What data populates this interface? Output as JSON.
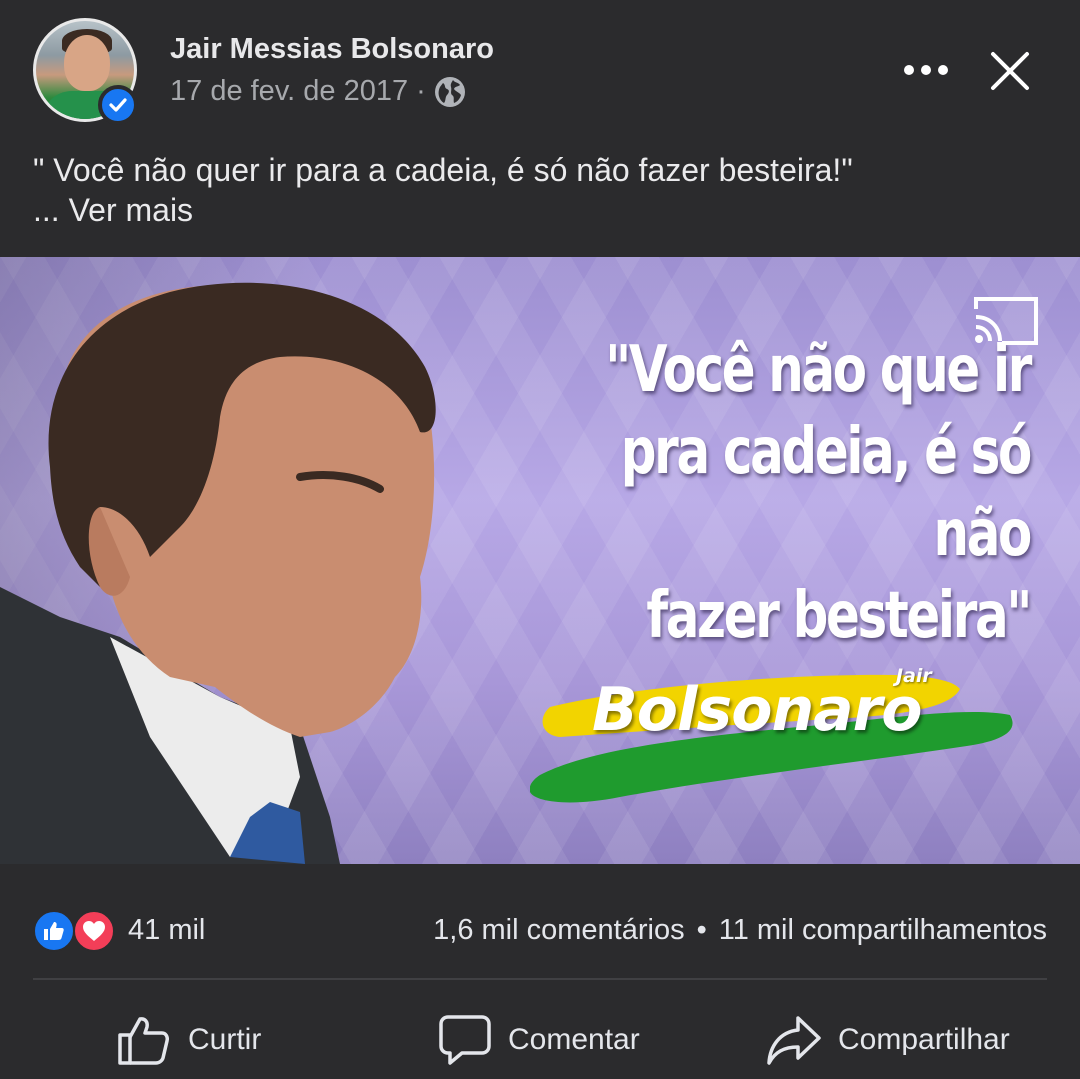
{
  "post": {
    "author": "Jair Messias Bolsonaro",
    "date": "17 de fev. de 2017",
    "separator": "·",
    "privacy_icon": "globe-icon",
    "text_line1": "\" Você não quer ir para a cadeia, é só não fazer besteira!\"",
    "text_line2": "... Ver mais"
  },
  "image": {
    "quote_line1": "\"Você não que ir",
    "quote_line2": "pra cadeia, é só não",
    "quote_line3": "fazer besteira\"",
    "logo_text": "Bolsonaro",
    "logo_small": "Jair",
    "colors": {
      "green": "#1f9b2e",
      "yellow": "#f2d400"
    }
  },
  "stats": {
    "reactions": "41 mil",
    "comments": "1,6 mil comentários",
    "dot": "•",
    "shares": "11 mil compartilhamentos"
  },
  "actions": {
    "like": "Curtir",
    "comment": "Comentar",
    "share": "Compartilhar"
  },
  "colors": {
    "background": "#2b2b2d",
    "accent_blue": "#1877f2",
    "love_red": "#f33e58"
  }
}
